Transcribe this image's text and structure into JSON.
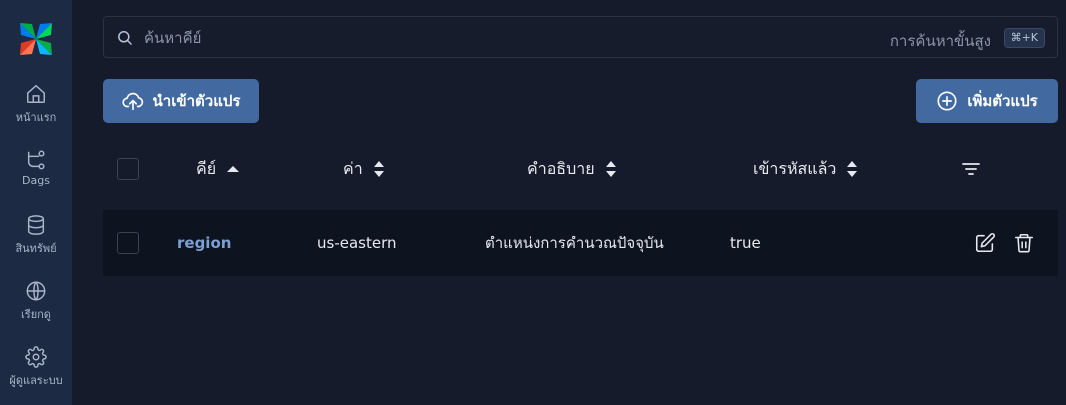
{
  "sidebar": {
    "items": [
      {
        "label": "หน้าแรก",
        "icon": "home-icon"
      },
      {
        "label": "Dags",
        "icon": "dag-icon"
      },
      {
        "label": "สินทรัพย์",
        "icon": "database-icon"
      },
      {
        "label": "เรียกดู",
        "icon": "globe-icon"
      },
      {
        "label": "ผู้ดูแลระบบ",
        "icon": "gear-icon"
      }
    ]
  },
  "search": {
    "placeholder": "ค้นหาคีย์",
    "advanced_label": "การค้นหาขั้นสูง",
    "shortcut": "⌘+K"
  },
  "toolbar": {
    "import_label": "นำเข้าตัวแปร",
    "add_label": "เพิ่มตัวแปร"
  },
  "table": {
    "columns": [
      {
        "label": "คีย์",
        "sort": "asc"
      },
      {
        "label": "ค่า",
        "sort": "none"
      },
      {
        "label": "คำอธิบาย",
        "sort": "none"
      },
      {
        "label": "เข้ารหัสแล้ว",
        "sort": "none"
      }
    ],
    "rows": [
      {
        "key": "region",
        "value": "us-eastern",
        "description": "ตำแหน่งการคำนวณปัจจุบัน",
        "encrypted": "true"
      }
    ]
  },
  "colors": {
    "accent": "#436aa0",
    "sidebar_bg": "#1c2a44",
    "page_bg": "#151b2b",
    "link": "#7ba0d4"
  }
}
